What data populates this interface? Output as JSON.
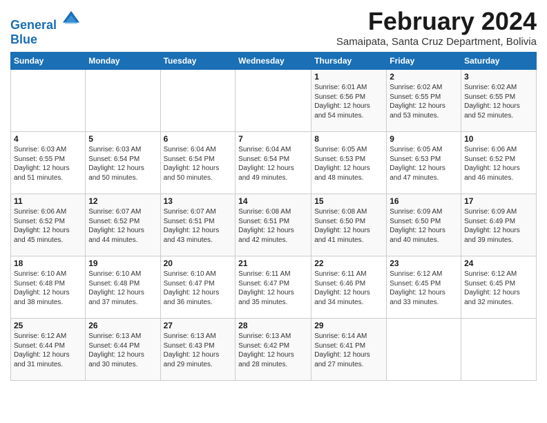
{
  "logo": {
    "line1": "General",
    "line2": "Blue"
  },
  "header": {
    "month_year": "February 2024",
    "location": "Samaipata, Santa Cruz Department, Bolivia"
  },
  "days_of_week": [
    "Sunday",
    "Monday",
    "Tuesday",
    "Wednesday",
    "Thursday",
    "Friday",
    "Saturday"
  ],
  "weeks": [
    [
      {
        "day": "",
        "info": ""
      },
      {
        "day": "",
        "info": ""
      },
      {
        "day": "",
        "info": ""
      },
      {
        "day": "",
        "info": ""
      },
      {
        "day": "1",
        "info": "Sunrise: 6:01 AM\nSunset: 6:56 PM\nDaylight: 12 hours\nand 54 minutes."
      },
      {
        "day": "2",
        "info": "Sunrise: 6:02 AM\nSunset: 6:55 PM\nDaylight: 12 hours\nand 53 minutes."
      },
      {
        "day": "3",
        "info": "Sunrise: 6:02 AM\nSunset: 6:55 PM\nDaylight: 12 hours\nand 52 minutes."
      }
    ],
    [
      {
        "day": "4",
        "info": "Sunrise: 6:03 AM\nSunset: 6:55 PM\nDaylight: 12 hours\nand 51 minutes."
      },
      {
        "day": "5",
        "info": "Sunrise: 6:03 AM\nSunset: 6:54 PM\nDaylight: 12 hours\nand 50 minutes."
      },
      {
        "day": "6",
        "info": "Sunrise: 6:04 AM\nSunset: 6:54 PM\nDaylight: 12 hours\nand 50 minutes."
      },
      {
        "day": "7",
        "info": "Sunrise: 6:04 AM\nSunset: 6:54 PM\nDaylight: 12 hours\nand 49 minutes."
      },
      {
        "day": "8",
        "info": "Sunrise: 6:05 AM\nSunset: 6:53 PM\nDaylight: 12 hours\nand 48 minutes."
      },
      {
        "day": "9",
        "info": "Sunrise: 6:05 AM\nSunset: 6:53 PM\nDaylight: 12 hours\nand 47 minutes."
      },
      {
        "day": "10",
        "info": "Sunrise: 6:06 AM\nSunset: 6:52 PM\nDaylight: 12 hours\nand 46 minutes."
      }
    ],
    [
      {
        "day": "11",
        "info": "Sunrise: 6:06 AM\nSunset: 6:52 PM\nDaylight: 12 hours\nand 45 minutes."
      },
      {
        "day": "12",
        "info": "Sunrise: 6:07 AM\nSunset: 6:52 PM\nDaylight: 12 hours\nand 44 minutes."
      },
      {
        "day": "13",
        "info": "Sunrise: 6:07 AM\nSunset: 6:51 PM\nDaylight: 12 hours\nand 43 minutes."
      },
      {
        "day": "14",
        "info": "Sunrise: 6:08 AM\nSunset: 6:51 PM\nDaylight: 12 hours\nand 42 minutes."
      },
      {
        "day": "15",
        "info": "Sunrise: 6:08 AM\nSunset: 6:50 PM\nDaylight: 12 hours\nand 41 minutes."
      },
      {
        "day": "16",
        "info": "Sunrise: 6:09 AM\nSunset: 6:50 PM\nDaylight: 12 hours\nand 40 minutes."
      },
      {
        "day": "17",
        "info": "Sunrise: 6:09 AM\nSunset: 6:49 PM\nDaylight: 12 hours\nand 39 minutes."
      }
    ],
    [
      {
        "day": "18",
        "info": "Sunrise: 6:10 AM\nSunset: 6:48 PM\nDaylight: 12 hours\nand 38 minutes."
      },
      {
        "day": "19",
        "info": "Sunrise: 6:10 AM\nSunset: 6:48 PM\nDaylight: 12 hours\nand 37 minutes."
      },
      {
        "day": "20",
        "info": "Sunrise: 6:10 AM\nSunset: 6:47 PM\nDaylight: 12 hours\nand 36 minutes."
      },
      {
        "day": "21",
        "info": "Sunrise: 6:11 AM\nSunset: 6:47 PM\nDaylight: 12 hours\nand 35 minutes."
      },
      {
        "day": "22",
        "info": "Sunrise: 6:11 AM\nSunset: 6:46 PM\nDaylight: 12 hours\nand 34 minutes."
      },
      {
        "day": "23",
        "info": "Sunrise: 6:12 AM\nSunset: 6:45 PM\nDaylight: 12 hours\nand 33 minutes."
      },
      {
        "day": "24",
        "info": "Sunrise: 6:12 AM\nSunset: 6:45 PM\nDaylight: 12 hours\nand 32 minutes."
      }
    ],
    [
      {
        "day": "25",
        "info": "Sunrise: 6:12 AM\nSunset: 6:44 PM\nDaylight: 12 hours\nand 31 minutes."
      },
      {
        "day": "26",
        "info": "Sunrise: 6:13 AM\nSunset: 6:44 PM\nDaylight: 12 hours\nand 30 minutes."
      },
      {
        "day": "27",
        "info": "Sunrise: 6:13 AM\nSunset: 6:43 PM\nDaylight: 12 hours\nand 29 minutes."
      },
      {
        "day": "28",
        "info": "Sunrise: 6:13 AM\nSunset: 6:42 PM\nDaylight: 12 hours\nand 28 minutes."
      },
      {
        "day": "29",
        "info": "Sunrise: 6:14 AM\nSunset: 6:41 PM\nDaylight: 12 hours\nand 27 minutes."
      },
      {
        "day": "",
        "info": ""
      },
      {
        "day": "",
        "info": ""
      }
    ]
  ]
}
